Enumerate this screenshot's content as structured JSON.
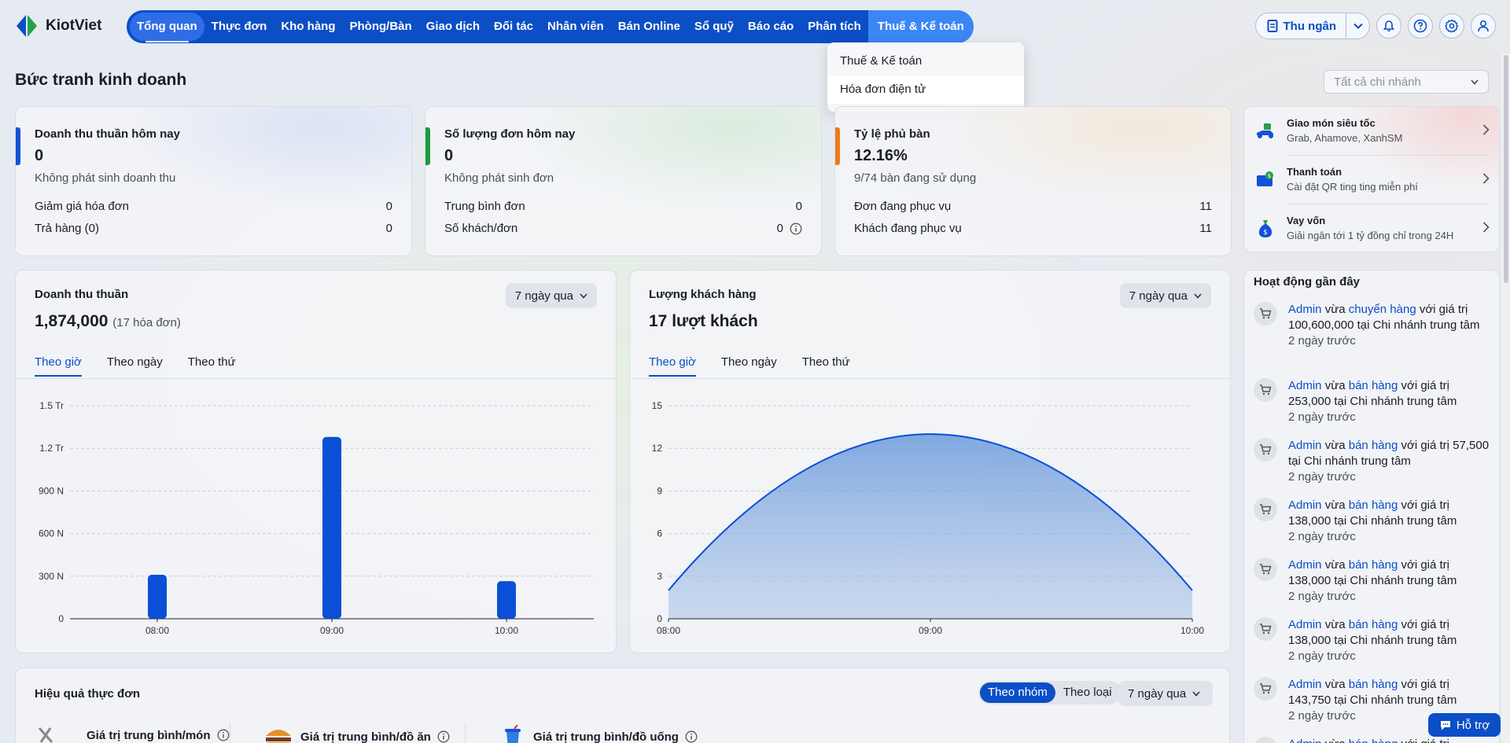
{
  "app": {
    "logo_text": "KiotViet"
  },
  "nav": {
    "items": [
      "Tổng quan",
      "Thực đơn",
      "Kho hàng",
      "Phòng/Bàn",
      "Giao dịch",
      "Đối tác",
      "Nhân viên",
      "Bán Online",
      "Sổ quỹ",
      "Báo cáo",
      "Phân tích",
      "Thuế & Kế toán"
    ]
  },
  "toolbar": {
    "cashier_label": "Thu ngân"
  },
  "dropdown": {
    "items": [
      "Thuế & Kế toán",
      "Hóa đơn điện tử"
    ]
  },
  "page": {
    "title": "Bức tranh kinh doanh",
    "branch_placeholder": "Tất cả chi nhánh"
  },
  "kpis": [
    {
      "label": "Doanh thu thuần hôm nay",
      "value": "0",
      "sub": "Không phát sinh doanh thu",
      "rows": [
        {
          "k": "Giảm giá hóa đơn",
          "v": "0"
        },
        {
          "k": "Trả hàng (0)",
          "v": "0"
        }
      ],
      "color": "#1550d8"
    },
    {
      "label": "Số lượng đơn hôm nay",
      "value": "0",
      "sub": "Không phát sinh đơn",
      "rows": [
        {
          "k": "Trung bình đơn",
          "v": "0"
        },
        {
          "k": "Số khách/đơn",
          "v": "0"
        }
      ],
      "color": "#1e9b3c"
    },
    {
      "label": "Tỷ lệ phủ bàn",
      "value": "12.16%",
      "sub": "9/74 bàn đang sử dụng",
      "rows": [
        {
          "k": "Đơn đang phục vụ",
          "v": "11"
        },
        {
          "k": "Khách đang phục vụ",
          "v": "11"
        }
      ],
      "color": "#f07a1a"
    }
  ],
  "services": [
    {
      "title": "Giao món siêu tốc",
      "desc": "Grab, Ahamove, XanhSM",
      "icon": "scooter-icon"
    },
    {
      "title": "Thanh toán",
      "desc": "Cài đặt QR ting ting miễn phí",
      "icon": "qr-payment-icon"
    },
    {
      "title": "Vay vốn",
      "desc": "Giải ngân tới 1 tỷ đồng chỉ trong 24H",
      "icon": "money-bag-icon"
    }
  ],
  "revenue_card": {
    "title": "Doanh thu thuần",
    "total": "1,874,000",
    "note": "(17 hóa đơn)",
    "period": "7 ngày qua",
    "tabs": [
      "Theo giờ",
      "Theo ngày",
      "Theo thứ"
    ]
  },
  "customer_card": {
    "title": "Lượng khách hàng",
    "total": "17 lượt khách",
    "period": "7 ngày qua",
    "tabs": [
      "Theo giờ",
      "Theo ngày",
      "Theo thứ"
    ]
  },
  "chart_data": [
    {
      "type": "bar",
      "categories": [
        "08:00",
        "09:00",
        "10:00"
      ],
      "values": [
        310000,
        1280000,
        265000
      ],
      "ylim": [
        0,
        1500000
      ],
      "yticks": [
        "0",
        "300 N",
        "600 N",
        "900 N",
        "1.2 Tr",
        "1.5 Tr"
      ],
      "color": "#0a4fd6"
    },
    {
      "type": "area",
      "x": [
        "08:00",
        "09:00",
        "10:00"
      ],
      "values": [
        2,
        13,
        2
      ],
      "ylim": [
        0,
        15
      ],
      "yticks": [
        "0",
        "3",
        "6",
        "9",
        "12",
        "15"
      ],
      "color": "#0a4fd6"
    }
  ],
  "activity": {
    "title": "Hoạt động gần đây",
    "items": [
      {
        "user": "Admin",
        "verb": " vừa ",
        "action": "chuyển hàng",
        "rest": " với giá trị 100,600,000 tại Chi nhánh trung tâm",
        "time": "2 ngày trước",
        "icon": "transfer-cart-icon"
      },
      {
        "user": "Admin",
        "verb": " vừa ",
        "action": "bán hàng",
        "rest": " với giá trị 253,000 tại Chi nhánh trung tâm",
        "time": "2 ngày trước",
        "icon": "cart-icon"
      },
      {
        "user": "Admin",
        "verb": " vừa ",
        "action": "bán hàng",
        "rest": " với giá trị 57,500 tại Chi nhánh trung tâm",
        "time": "2 ngày trước",
        "icon": "cart-icon"
      },
      {
        "user": "Admin",
        "verb": " vừa ",
        "action": "bán hàng",
        "rest": " với giá trị 138,000 tại Chi nhánh trung tâm",
        "time": "2 ngày trước",
        "icon": "cart-icon"
      },
      {
        "user": "Admin",
        "verb": " vừa ",
        "action": "bán hàng",
        "rest": " với giá trị 138,000 tại Chi nhánh trung tâm",
        "time": "2 ngày trước",
        "icon": "cart-icon"
      },
      {
        "user": "Admin",
        "verb": " vừa ",
        "action": "bán hàng",
        "rest": " với giá trị 138,000 tại Chi nhánh trung tâm",
        "time": "2 ngày trước",
        "icon": "cart-icon"
      },
      {
        "user": "Admin",
        "verb": " vừa ",
        "action": "bán hàng",
        "rest": " với giá trị 143,750 tại Chi nhánh trung tâm",
        "time": "2 ngày trước",
        "icon": "cart-icon"
      },
      {
        "user": "Admin",
        "verb": " vừa ",
        "action": "bán hàng",
        "rest": " với giá trị",
        "time": "",
        "icon": "cart-icon"
      }
    ]
  },
  "menu_effect": {
    "title": "Hiệu quả thực đơn",
    "seg": [
      "Theo nhóm",
      "Theo loại"
    ],
    "period": "7 ngày qua",
    "metrics": [
      "Giá trị trung bình/món",
      "Giá trị trung bình/đồ ăn",
      "Giá trị trung bình/đồ uống"
    ]
  },
  "support": {
    "label": "Hỗ trợ"
  }
}
